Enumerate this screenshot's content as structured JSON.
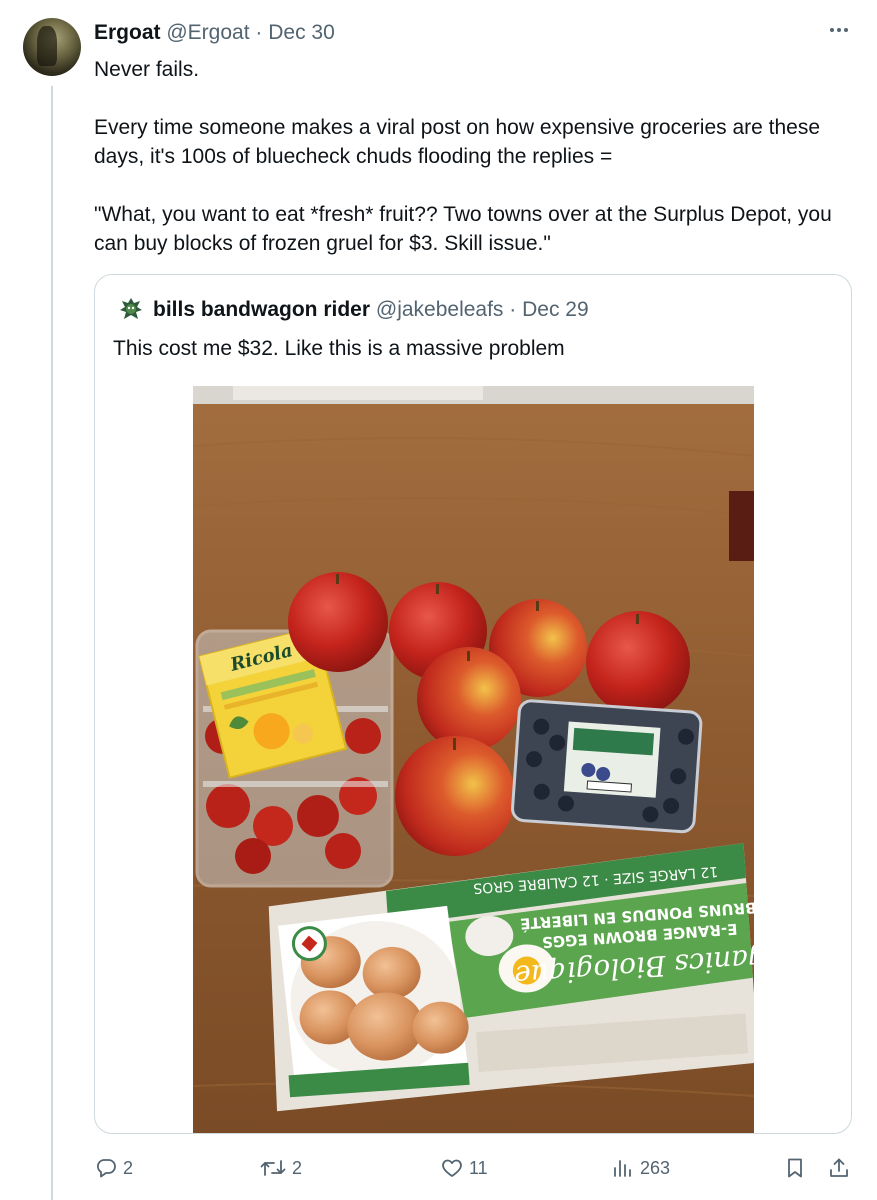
{
  "tweet": {
    "author_name": "Ergoat",
    "author_handle": "@Ergoat",
    "separator": "·",
    "date": "Dec 30",
    "text_paragraphs": [
      "Never fails.",
      "Every time someone makes a viral post on how expensive groceries are these days, it's 100s of bluecheck chuds flooding the replies =",
      "\"What, you want to eat *fresh* fruit?? Two towns over at the Surplus Depot, you can buy blocks of frozen gruel for $3. Skill issue.\""
    ]
  },
  "quote": {
    "author_name": "bills bandwagon rider",
    "author_handle": "@jakebeleafs",
    "separator": "·",
    "date": "Dec 29",
    "text": "This cost me $32. Like this is a massive problem",
    "photo": {
      "ricola_label": "Ricola",
      "egg_carton_lines": [
        "rganics Biologique",
        "E-RANGE BROWN EGGS",
        "BRUNS PONDUS EN LIBERTÉ",
        "12 LARGE SIZE · 12 CALIBRE GROS"
      ]
    }
  },
  "actions": {
    "reply_count": "2",
    "retweet_count": "2",
    "like_count": "11",
    "views_count": "263"
  },
  "icons": {
    "more": "more-icon",
    "reply": "reply-icon",
    "retweet": "retweet-icon",
    "like": "heart-icon",
    "views": "views-icon",
    "bookmark": "bookmark-icon",
    "share": "share-icon"
  },
  "colors": {
    "text": "#0f1419",
    "muted": "#536471",
    "border": "#cfd9de"
  }
}
